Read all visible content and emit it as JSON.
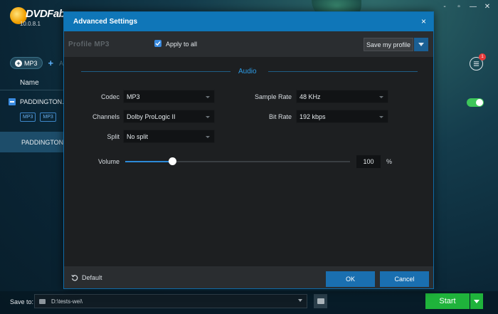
{
  "app": {
    "logo_text": "DVDFab",
    "version": "10.0.8.1",
    "window_controls": [
      "-",
      "▫",
      "—",
      "✕"
    ]
  },
  "left_panel": {
    "mp3_pill_label": "MP3",
    "add_text": "A",
    "column_name": "Name",
    "row1_title": "PADDINGTON.T",
    "tags": [
      "MP3",
      "MP3"
    ],
    "row2_title": "PADDINGTON.T"
  },
  "notifications": {
    "count": "1"
  },
  "bottom": {
    "save_to_label": "Save to:",
    "path": "D:\\tests-wei\\",
    "start_label": "Start"
  },
  "dialog": {
    "title": "Advanced Settings",
    "close": "×",
    "profile_label": "Profile",
    "profile_value": "MP3",
    "apply_to_all_label": "Apply to all",
    "apply_to_all_checked": true,
    "save_profile_label": "Save my profile",
    "section_title": "Audio",
    "fields": {
      "codec": {
        "label": "Codec",
        "value": "MP3"
      },
      "channels": {
        "label": "Channels",
        "value": "Dolby ProLogic II"
      },
      "split": {
        "label": "Split",
        "value": "No split"
      },
      "sample_rate": {
        "label": "Sample Rate",
        "value": "48 KHz"
      },
      "bit_rate": {
        "label": "Bit Rate",
        "value": "192 kbps"
      }
    },
    "volume": {
      "label": "Volume",
      "value": "100",
      "unit": "%",
      "fraction": 0.21
    },
    "default_label": "Default",
    "ok_label": "OK",
    "cancel_label": "Cancel"
  },
  "colors": {
    "accent_blue": "#0f76b8",
    "start_green": "#1fb33b",
    "toggle_green": "#3ec65a",
    "badge_red": "#e53a3a"
  }
}
